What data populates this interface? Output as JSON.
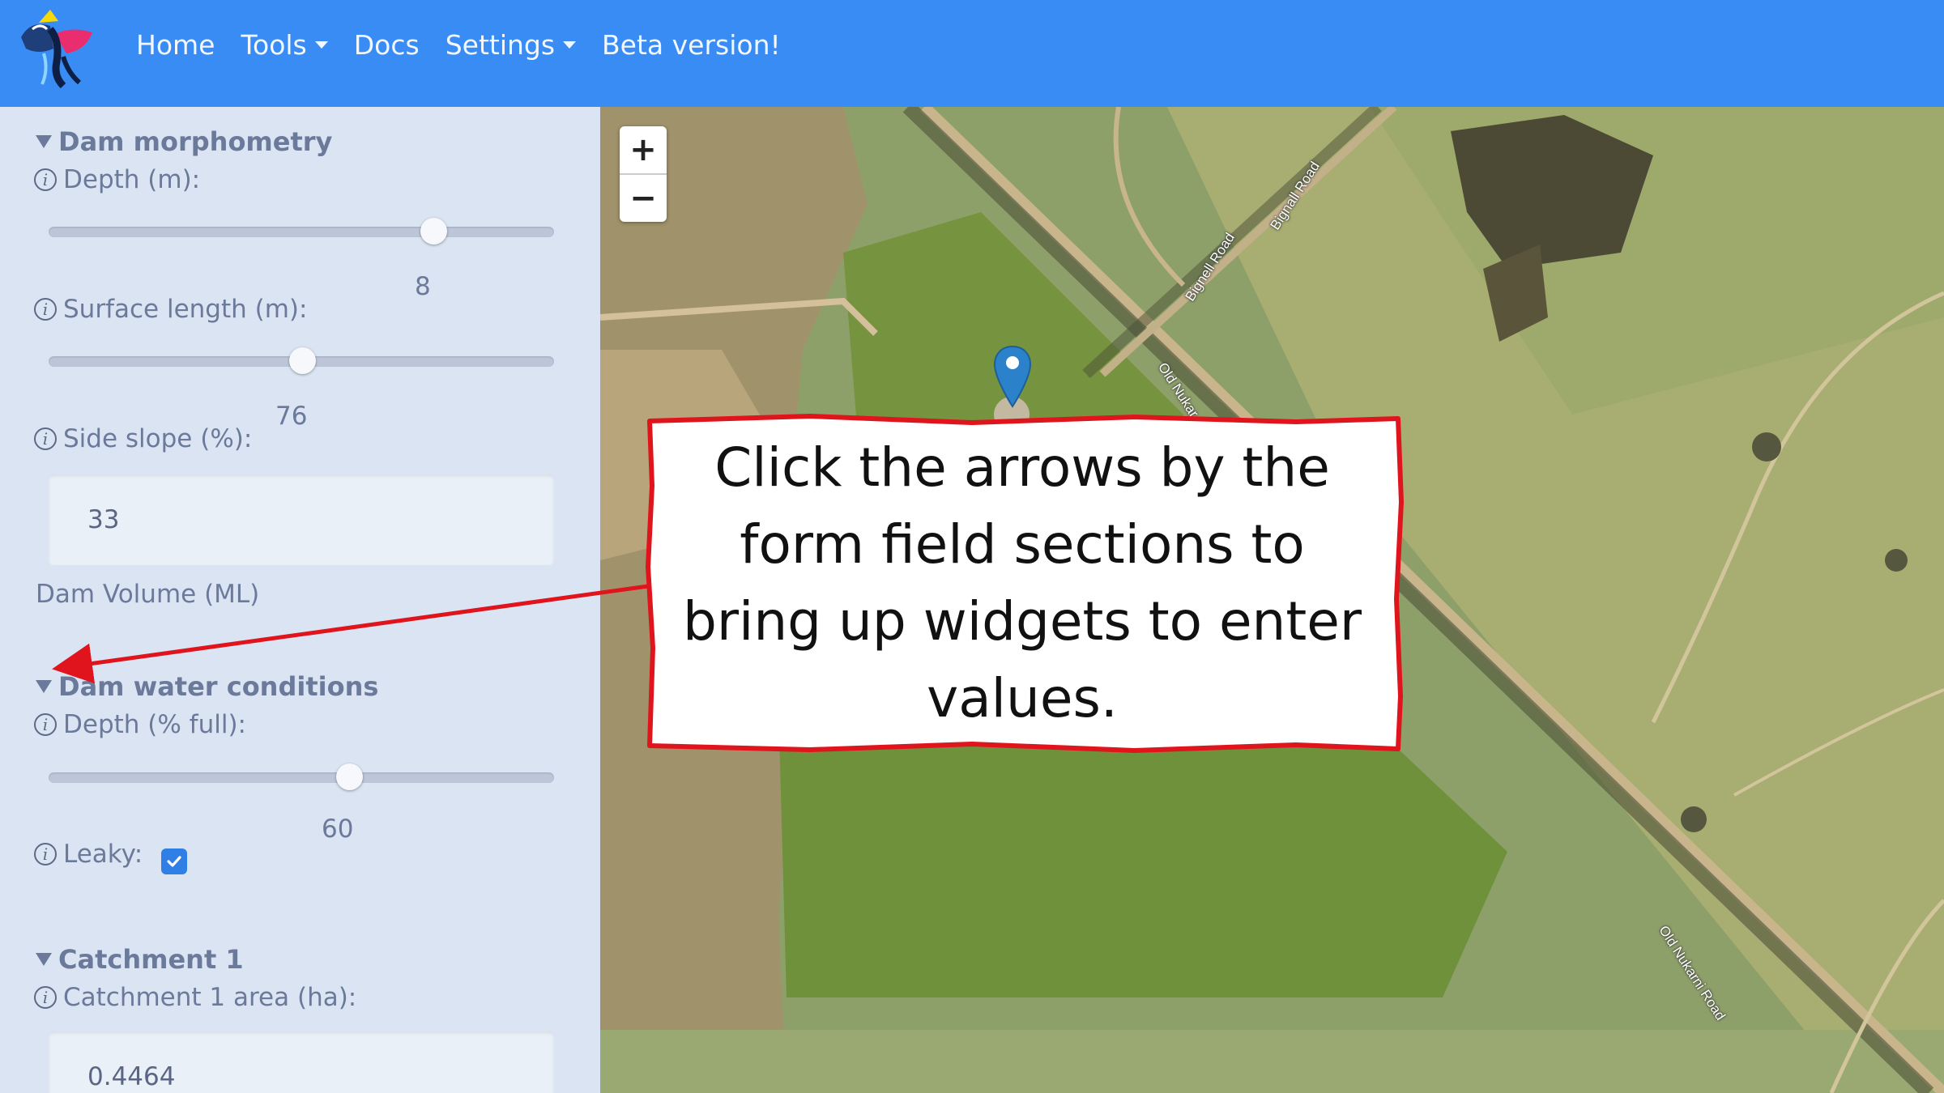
{
  "navbar": {
    "items": [
      {
        "label": "Home"
      },
      {
        "label": "Tools"
      },
      {
        "label": "Docs"
      },
      {
        "label": "Settings"
      },
      {
        "label": "Beta version!"
      }
    ],
    "bg_color": "#3a8cf5"
  },
  "sidebar": {
    "dam_morphometry": {
      "title": "Dam morphometry",
      "depth": {
        "label": "Depth (m):",
        "value": "8"
      },
      "surface_length": {
        "label": "Surface length (m):",
        "value": "76"
      },
      "side_slope": {
        "label": "Side slope (%):",
        "value": "33"
      },
      "dam_volume": {
        "label": "Dam Volume (ML)"
      }
    },
    "dam_water_conditions": {
      "title": "Dam water conditions",
      "depth_full": {
        "label": "Depth (% full):",
        "value": "60"
      },
      "leaky": {
        "label": "Leaky:",
        "checked": true
      }
    },
    "catchment_1": {
      "title": "Catchment 1",
      "area": {
        "label": "Catchment 1 area (ha):",
        "value": "0.4464"
      }
    }
  },
  "map": {
    "zoom_in": "+",
    "zoom_out": "−",
    "roads": [
      "Bignall Road",
      "Bignell Road",
      "Old Nukar",
      "Old Nukarni Road"
    ]
  },
  "callout": {
    "text": "Click the arrows by the form field sections to bring up widgets to enter values.",
    "border_color": "#e0141c"
  }
}
